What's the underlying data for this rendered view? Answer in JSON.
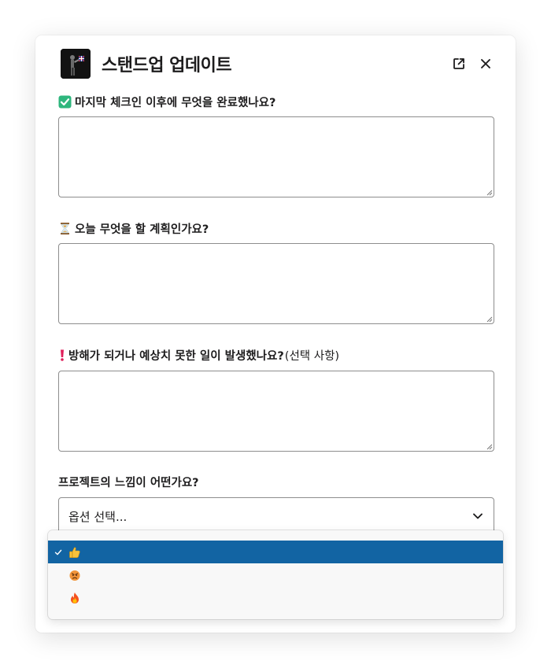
{
  "modal": {
    "title": "스탠드업 업데이트",
    "open_external_icon": "open-in-new-window-icon",
    "close_icon": "close-icon"
  },
  "fields": [
    {
      "emoji": "white-check-mark-icon",
      "label": "마지막 체크인 이후에 무엇을 완료했나요?",
      "value": "",
      "placeholder": ""
    },
    {
      "emoji": "hourglass-icon",
      "label": "오늘 무엇을 할 계획인가요?",
      "value": "",
      "placeholder": ""
    },
    {
      "emoji": "exclamation-icon",
      "label": "방해가 되거나 예상치 못한 일이 발생했나요?",
      "optional": "(선택 사항)",
      "value": "",
      "placeholder": ""
    }
  ],
  "mood": {
    "label": "프로젝트의 느낌이 어떤가요?",
    "placeholder": "옵션 선택...",
    "chevron_icon": "chevron-down-icon",
    "options": [
      {
        "emoji": "thumbs-up-icon",
        "selected": true,
        "check_icon": "checkmark-icon"
      },
      {
        "emoji": "angry-face-icon",
        "selected": false
      },
      {
        "emoji": "fire-icon",
        "selected": false
      }
    ]
  },
  "colors": {
    "selected_option_bg": "#1264a3",
    "border": "#8d8d8d",
    "check_green": "#2eb67d",
    "exclamation_red": "#e01e5a"
  }
}
